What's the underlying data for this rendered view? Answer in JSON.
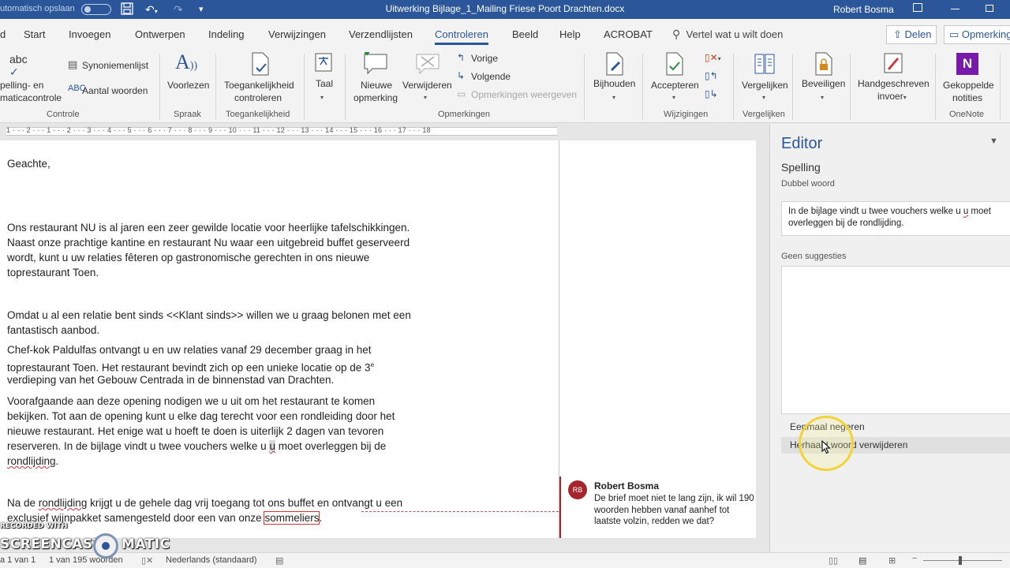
{
  "titlebar": {
    "autosave": "utomatisch opslaan",
    "title": "Uitwerking Bijlage_1_Mailing Friese Poort Drachten.docx",
    "user": "Robert Bosma"
  },
  "tabs": [
    "d",
    "Start",
    "Invoegen",
    "Ontwerpen",
    "Indeling",
    "Verwijzingen",
    "Verzendlijsten",
    "Controleren",
    "Beeld",
    "Help",
    "ACROBAT"
  ],
  "active_tab": "Controleren",
  "search": "Vertel wat u wilt doen",
  "share": "Delen",
  "comments": "Opmerkingen",
  "ribbon": {
    "controle": {
      "group": "Controle",
      "spelling_1": "pelling- en",
      "spelling_2": "maticacontrole",
      "synonym": "Synoniemenlijst",
      "wordcount": "Aantal woorden"
    },
    "spraak": {
      "group": "Spraak",
      "readaloud": "Voorlezen"
    },
    "toegankelijkheid": {
      "group": "Toegankelijkheid",
      "check_1": "Toegankelijkheid",
      "check_2": "controleren"
    },
    "taal": {
      "label": "Taal"
    },
    "opmerkingen": {
      "group": "Opmerkingen",
      "new_1": "Nieuwe",
      "new_2": "opmerking",
      "delete": "Verwijderen",
      "prev": "Vorige",
      "next": "Volgende",
      "show": "Opmerkingen weergeven"
    },
    "bijhouden": {
      "label": "Bijhouden"
    },
    "wijzigingen": {
      "group": "Wijzigingen",
      "accept": "Accepteren"
    },
    "vergelijken": {
      "group": "Vergelijken",
      "compare": "Vergelijken"
    },
    "beveiligen": {
      "label": "Beveiligen"
    },
    "ink": {
      "label_1": "Handgeschreven",
      "label_2": "invoer"
    },
    "onenote": {
      "group": "OneNote",
      "label_1": "Gekoppelde",
      "label_2": "notities"
    }
  },
  "ruler": "1 · · · 2 · · · 1 · · · 2 · · · 3 · · · 4 · · · 5 · · · 6 · · · 7 · · · 8 · · · 9 · · · 10 · · · 11 · · · 12 · · · 13 · · · 14 · · · 15 · · · 16 · · · 17 · · · 18",
  "document": {
    "salutation": "Geachte,",
    "p1": [
      "Ons restaurant NU is al jaren een zeer gewilde locatie voor heerlijke tafelschikkingen.",
      "Naast onze prachtige kantine en restaurant Nu waar een uitgebreid buffet geserveerd",
      "wordt, kunt u uw relaties fêteren op gastronomische gerechten in ons nieuwe",
      "toprestaurant Toen."
    ],
    "p2": [
      "Omdat u al een relatie bent sinds <<Klant sinds>> willen we u graag belonen met een",
      "fantastisch aanbod."
    ],
    "p3": [
      "Chef-kok Paldulfas ontvangt u en uw relaties vanaf 29 december graag in het",
      "toprestaurant Toen. Het restaurant bevindt zich op een unieke locatie op de 3",
      "verdieping van het Gebouw Centrada in de binnenstad van Drachten."
    ],
    "p3_sup": "e",
    "p4": [
      "Voorafgaande aan deze opening nodigen we u uit om het restaurant te komen",
      "bekijken. Tot aan de opening kunt u elke dag terecht voor een rondleiding door het",
      "nieuwe restaurant. Het enige wat u hoeft te doen is uiterlijk 2 dagen van tevoren"
    ],
    "p4_l4_a": "reserveren. In de bijlage vindt u twee vouchers welke u ",
    "p4_l4_b": "u",
    "p4_l4_c": " moet overleggen bij de",
    "p4_l5": "rondlijding",
    "p4_l5_end": ".",
    "p5_l1_a": "Na de ",
    "p5_l1_b": "rondlijding",
    "p5_l1_c": " krijgt u de gehele dag vrij toegang tot ons buffet en ontvangt u een",
    "p5_l2_a": "exclusief wijnpakket samengesteld door een van onze ",
    "p5_l2_b": "sommeliers",
    "p5_l2_c": "."
  },
  "comment": {
    "initials": "RB",
    "author": "Robert Bosma",
    "text": "De brief moet niet te lang zijn, ik wil 190 woorden hebben vanaf aanhef tot laatste volzin, redden we dat?"
  },
  "editor": {
    "title": "Editor",
    "section": "Spelling",
    "issue": "Dubbel woord",
    "context_a": "In de bijlage vindt u twee vouchers welke u ",
    "context_b": "u",
    "context_c": " moet overleggen bij de rondlijding.",
    "suggestions_label": "Geen suggesties",
    "ignore": "Eenmaal negeren",
    "remove": "Herhaald woord verwijderen"
  },
  "status": {
    "page": "a 1 van 1",
    "words": "1 van 195 woorden",
    "language": "Nederlands (standaard)"
  },
  "watermark": {
    "small": "RECORDED WITH",
    "big_a": "SCREENCAST",
    "big_b": "MATIC"
  },
  "colors": {
    "word_blue": "#2b579a",
    "error_red": "#d13438",
    "comment_red": "#a4262c"
  }
}
